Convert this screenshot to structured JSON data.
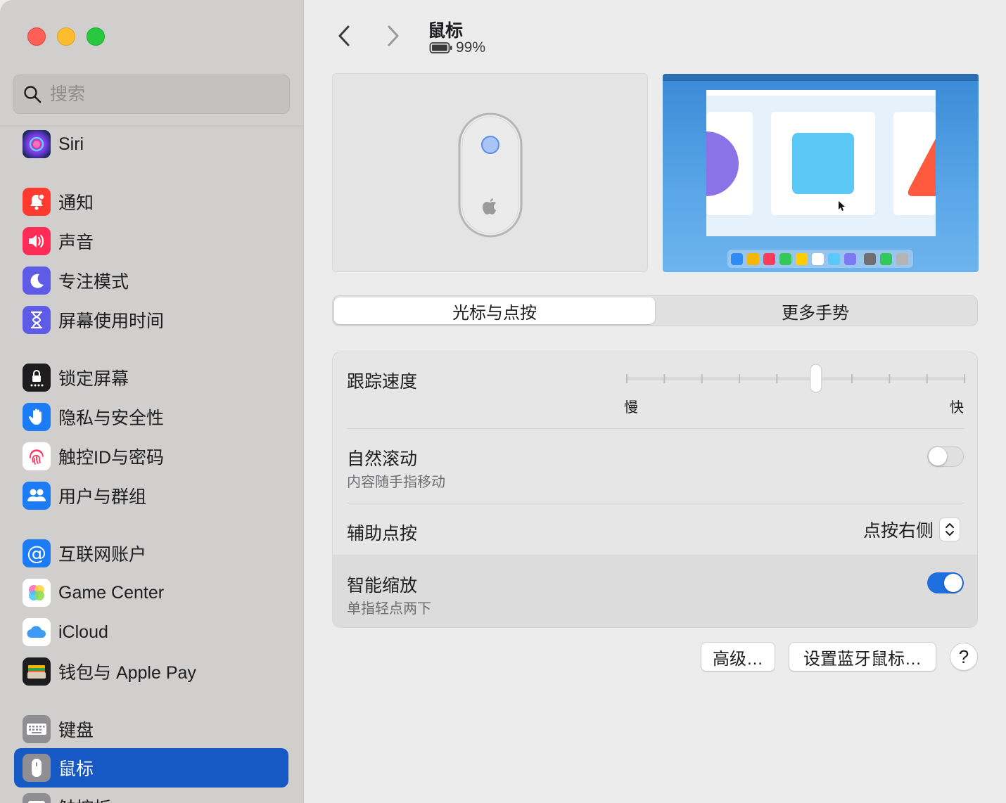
{
  "window": {
    "controls": [
      "close",
      "minimize",
      "zoom"
    ]
  },
  "search": {
    "placeholder": "搜索"
  },
  "sidebar": {
    "items": [
      {
        "label": "Siri",
        "icon": "siri-icon",
        "color": "#2b2b5e"
      },
      {
        "label": "通知",
        "icon": "bell-icon",
        "color": "#ff3b30"
      },
      {
        "label": "声音",
        "icon": "speaker-icon",
        "color": "#ff2d55"
      },
      {
        "label": "专注模式",
        "icon": "moon-icon",
        "color": "#5e5ce6"
      },
      {
        "label": "屏幕使用时间",
        "icon": "hourglass-icon",
        "color": "#5e5ce6"
      },
      {
        "label": "锁定屏幕",
        "icon": "lock-icon",
        "color": "#1d1d1f"
      },
      {
        "label": "隐私与安全性",
        "icon": "hand-icon",
        "color": "#1c7cf5"
      },
      {
        "label": "触控ID与密码",
        "icon": "fingerprint-icon",
        "color": "#ffffff"
      },
      {
        "label": "用户与群组",
        "icon": "users-icon",
        "color": "#1c7cf5"
      },
      {
        "label": "互联网账户",
        "icon": "at-icon",
        "color": "#1c7cf5"
      },
      {
        "label": "Game Center",
        "icon": "game-center-icon",
        "color": "#ffffff"
      },
      {
        "label": "iCloud",
        "icon": "cloud-icon",
        "color": "#ffffff"
      },
      {
        "label": "钱包与 Apple Pay",
        "icon": "wallet-icon",
        "color": "#1d1d1f"
      },
      {
        "label": "键盘",
        "icon": "keyboard-icon",
        "color": "#8e8e93"
      },
      {
        "label": "鼠标",
        "icon": "mouse-icon",
        "color": "#8e8e93",
        "selected": true
      },
      {
        "label": "触控板",
        "icon": "trackpad-icon",
        "color": "#8e8e93"
      }
    ]
  },
  "header": {
    "title": "鼠标",
    "battery": "99%",
    "battery_level": 0.99
  },
  "tabs": [
    {
      "label": "光标与点按",
      "active": true
    },
    {
      "label": "更多手势",
      "active": false
    }
  ],
  "settings": {
    "tracking": {
      "label": "跟踪速度",
      "min_label": "慢",
      "max_label": "快",
      "value": 0.56
    },
    "natural_scroll": {
      "label": "自然滚动",
      "sub": "内容随手指移动",
      "on": false
    },
    "secondary_click": {
      "label": "辅助点按",
      "value": "点按右侧"
    },
    "smart_zoom": {
      "label": "智能缩放",
      "sub": "单指轻点两下",
      "on": true
    }
  },
  "buttons": {
    "advanced": "高级…",
    "setup_bluetooth": "设置蓝牙鼠标…",
    "help": "?"
  },
  "colors": {
    "accent": "#1f6fe0",
    "sidebar_selected": "#1759c4"
  }
}
